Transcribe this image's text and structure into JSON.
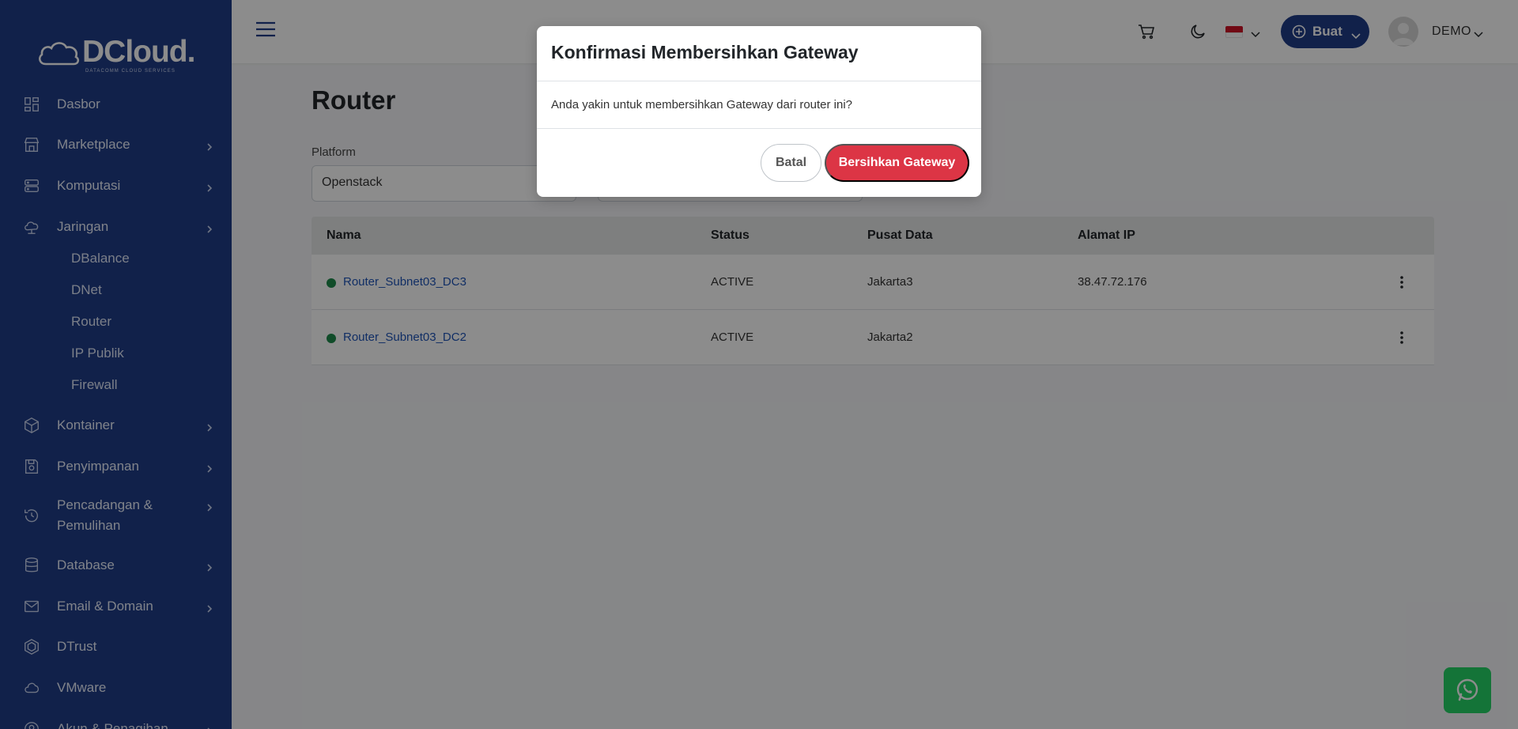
{
  "brand": {
    "name": "DCloud.",
    "tagline": "DATACOMM CLOUD SERVICES"
  },
  "sidebar": {
    "items": [
      {
        "label": "Dasbor",
        "icon": "dashboard-icon",
        "chevron": false
      },
      {
        "label": "Marketplace",
        "icon": "store-icon",
        "chevron": true
      },
      {
        "label": "Komputasi",
        "icon": "server-icon",
        "chevron": true
      },
      {
        "label": "Jaringan",
        "icon": "cloud-network-icon",
        "chevron": true
      },
      {
        "label": "Kontainer",
        "icon": "box-icon",
        "chevron": true
      },
      {
        "label": "Penyimpanan",
        "icon": "storage-icon",
        "chevron": true
      },
      {
        "label": "Pencadangan &",
        "label2": "Pemulihan",
        "icon": "backup-icon",
        "chevron": true
      },
      {
        "label": "Database",
        "icon": "database-icon",
        "chevron": true
      },
      {
        "label": "Email & Domain",
        "icon": "mail-icon",
        "chevron": true
      },
      {
        "label": "DTrust",
        "icon": "shield-hex-icon",
        "chevron": false
      },
      {
        "label": "VMware",
        "icon": "cloud-icon",
        "chevron": false
      },
      {
        "label": "Akun & Penagihan",
        "icon": "account-icon",
        "chevron": true
      }
    ],
    "jaringan_sub": [
      "DBalance",
      "DNet",
      "Router",
      "IP Publik",
      "Firewall"
    ]
  },
  "topbar": {
    "create_label": "Buat",
    "user_name": "DEMO",
    "icons": [
      "hamburger-icon",
      "cart-icon",
      "moon-icon",
      "flag-indonesia-icon",
      "chevron-down-icon"
    ]
  },
  "page": {
    "title": "Router",
    "platform_label": "Platform",
    "platform_value": "Openstack"
  },
  "table": {
    "headers": [
      "Nama",
      "Status",
      "Pusat Data",
      "Alamat IP"
    ],
    "rows": [
      {
        "name": "Router_Subnet03_DC3",
        "status": "ACTIVE",
        "datacenter": "Jakarta3",
        "ip": "38.47.72.176"
      },
      {
        "name": "Router_Subnet03_DC2",
        "status": "ACTIVE",
        "datacenter": "Jakarta2",
        "ip": ""
      }
    ]
  },
  "modal": {
    "title": "Konfirmasi Membersihkan Gateway",
    "body": "Anda yakin untuk membersihkan Gateway dari router ini?",
    "cancel_label": "Batal",
    "confirm_label": "Bersihkan Gateway"
  },
  "colors": {
    "sidebar": "#1f3c88",
    "primary": "#1f3c88",
    "danger": "#dc3545",
    "status_active": "#1e8a4c",
    "whatsapp": "#25d366"
  }
}
